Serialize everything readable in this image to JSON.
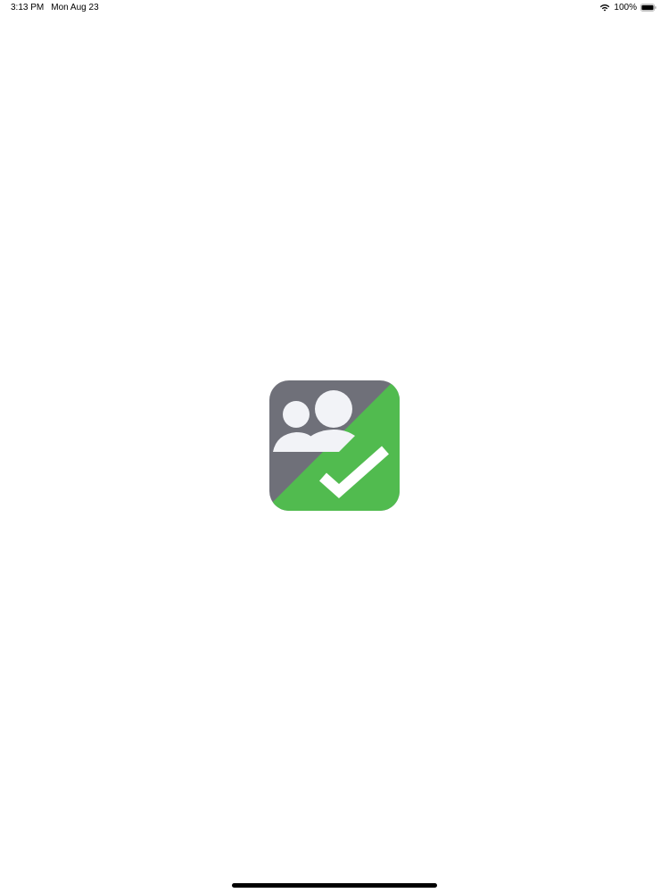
{
  "status_bar": {
    "time": "3:13 PM",
    "date": "Mon Aug 23",
    "battery_percent": "100%",
    "wifi_icon": "wifi-icon",
    "battery_icon": "battery-full-icon"
  },
  "splash": {
    "logo_icon": "group-attendance-check-icon",
    "colors": {
      "gray": "#6f7079",
      "green": "#51bb4f",
      "person": "#f2f3f7",
      "check": "#ffffff"
    }
  },
  "home_indicator": {
    "color": "#000000"
  }
}
